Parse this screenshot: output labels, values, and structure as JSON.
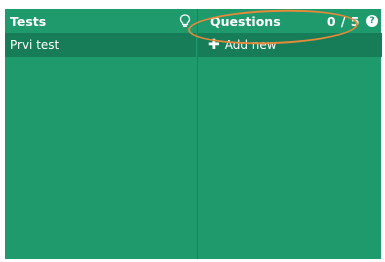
{
  "tests_panel": {
    "title": "Tests",
    "items": [
      {
        "label": "Prvi test"
      }
    ]
  },
  "questions_panel": {
    "title": "Questions",
    "count": "0 / 5",
    "add_new_label": "Add new",
    "help_icon_label": "?"
  },
  "annotation": {
    "highlight_color": "#e38a3b"
  },
  "colors": {
    "panel_bg": "#1f9a6d",
    "row_bg": "#177d58",
    "text": "#ffffff"
  },
  "icons": {
    "tests_header_icon": "lightbulb-icon",
    "add_icon": "plus-icon",
    "help_icon": "help-icon"
  }
}
